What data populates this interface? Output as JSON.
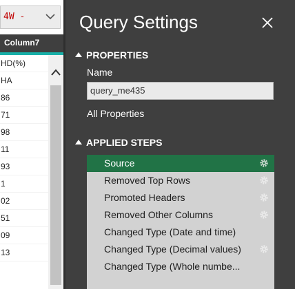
{
  "grid": {
    "filter_value": "4W -",
    "column_header": "Column7",
    "cells": [
      "HD(%)",
      "HA",
      "86",
      "71",
      "98",
      "11",
      "93",
      "1",
      "02",
      "51",
      "09",
      "13"
    ]
  },
  "panel": {
    "title": "Query Settings",
    "properties_section": "PROPERTIES",
    "name_label": "Name",
    "name_value": "query_me435",
    "all_properties_link": "All Properties",
    "applied_steps_section": "APPLIED STEPS",
    "steps": [
      {
        "label": "Source",
        "has_gear": true,
        "selected": true
      },
      {
        "label": "Removed Top Rows",
        "has_gear": true,
        "selected": false
      },
      {
        "label": "Promoted Headers",
        "has_gear": true,
        "selected": false
      },
      {
        "label": "Removed Other Columns",
        "has_gear": true,
        "selected": false
      },
      {
        "label": "Changed Type (Date and time)",
        "has_gear": false,
        "selected": false
      },
      {
        "label": "Changed Type (Decimal values)",
        "has_gear": true,
        "selected": false
      },
      {
        "label": "Changed Type (Whole numbe...",
        "has_gear": false,
        "selected": false
      }
    ]
  },
  "colors": {
    "panel_bg": "#3f3f3f",
    "selected_step": "#217346",
    "steps_bg": "#d2d2d2",
    "accent_teal": "#18b0a8",
    "filter_text": "#c00000"
  },
  "icons": {
    "close": "close-icon",
    "gear": "gear-icon",
    "section_toggle": "triangle-icon",
    "dropdown": "chevron-down-icon",
    "scroll_up": "chevron-up-icon"
  }
}
